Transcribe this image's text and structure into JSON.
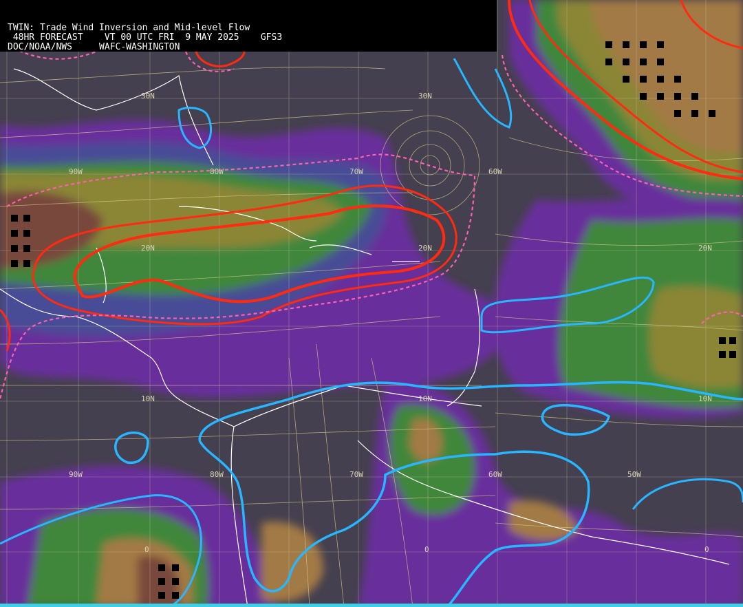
{
  "header": {
    "line1": "TWIN: Trade Wind Inversion and Mid-level Flow",
    "line2": " 48HR FORECAST    VT 00 UTC FRI  9 MAY 2025    GFS3",
    "line3": "DOC/NOAA/NWS     WAFC-WASHINGTON"
  },
  "lat_labels": [
    "30N",
    "30N",
    "20N",
    "20N",
    "20N",
    "10N",
    "10N",
    "10N",
    "0",
    "0",
    "0"
  ],
  "lon_labels": [
    "90W",
    "80W",
    "70W",
    "60W",
    "90W",
    "80W",
    "70W",
    "60W",
    "50W"
  ],
  "colors": {
    "background": "#45404f",
    "shade_purple": "#6a2fa0",
    "shade_blue": "#4a4e9a",
    "shade_green": "#3f8b3a",
    "shade_olive": "#8f8a35",
    "shade_tan": "#a87e45",
    "shade_brown": "#7b4a3a",
    "red_contour": "#ff2a10",
    "pink_dashed": "#ff5fb0",
    "cyan_contour": "#27b6ff",
    "streamline": "#d6c98a",
    "coastline": "#ffffff",
    "grid": "#c9c4a8"
  }
}
